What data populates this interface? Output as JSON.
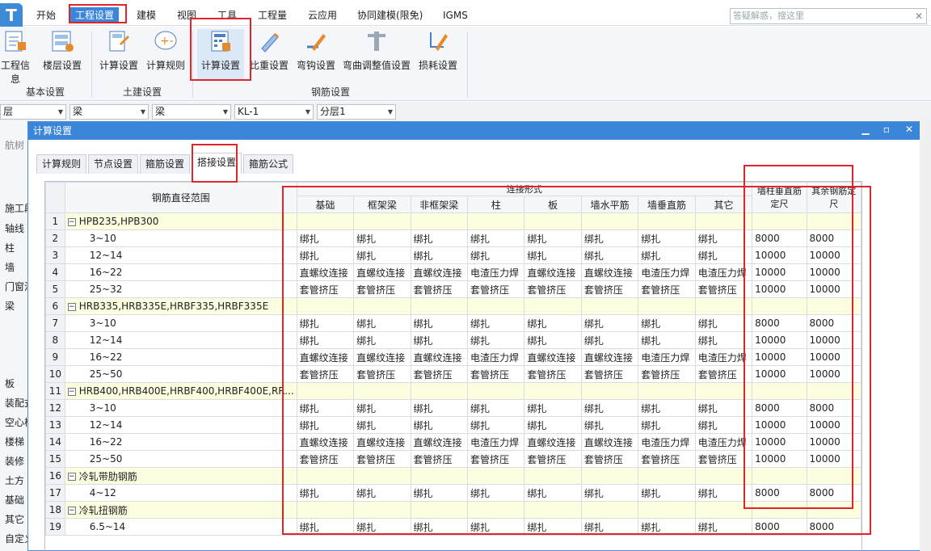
{
  "menu": {
    "items": [
      "开始",
      "工程设置",
      "建模",
      "视图",
      "工具",
      "工程量",
      "云应用",
      "协同建模(限免)",
      "IGMS"
    ],
    "active": "工程设置",
    "search_placeholder": "答疑解惑，搜这里",
    "search_clear": "✕"
  },
  "ribbon": {
    "buttons": [
      "工程信息",
      "楼层设置",
      "计算设置",
      "计算规则",
      "计算设置",
      "比重设置",
      "弯钩设置",
      "弯曲调整值设置",
      "损耗设置"
    ],
    "groups": [
      "基本设置",
      "土建设置",
      "钢筋设置"
    ]
  },
  "combos": [
    "层",
    "梁",
    "梁",
    "KL-1",
    "分层1"
  ],
  "left_nav": {
    "items": [
      "航树",
      "施工段",
      "轴线",
      "柱",
      "墙",
      "门窗洞",
      "梁",
      "板",
      "装配式",
      "空心楼",
      "楼梯",
      "装修",
      "土方",
      "基础",
      "其它",
      "自定义"
    ]
  },
  "dialog": {
    "title": "计算设置",
    "tabs": [
      "计算规则",
      "节点设置",
      "箍筋设置",
      "搭接设置",
      "箍筋公式"
    ],
    "active_tab": "搭接设置",
    "grid": {
      "range_header": "钢筋直径范围",
      "group_header": "连接形式",
      "col_headers": [
        "基础",
        "框架梁",
        "非框架梁",
        "柱",
        "板",
        "墙水平筋",
        "墙垂直筋",
        "其它"
      ],
      "extra_headers": [
        "墙柱垂直筋定尺",
        "其余钢筋定尺"
      ],
      "rows": [
        {
          "n": "1",
          "label": "HPB235,HPB300",
          "group": true,
          "cells": []
        },
        {
          "n": "2",
          "label": "3~10",
          "cells": [
            "绑扎",
            "绑扎",
            "绑扎",
            "绑扎",
            "绑扎",
            "绑扎",
            "绑扎",
            "绑扎",
            "8000",
            "8000"
          ]
        },
        {
          "n": "3",
          "label": "12~14",
          "cells": [
            "绑扎",
            "绑扎",
            "绑扎",
            "绑扎",
            "绑扎",
            "绑扎",
            "绑扎",
            "绑扎",
            "10000",
            "10000"
          ]
        },
        {
          "n": "4",
          "label": "16~22",
          "cells": [
            "直螺纹连接",
            "直螺纹连接",
            "直螺纹连接",
            "电渣压力焊",
            "直螺纹连接",
            "直螺纹连接",
            "电渣压力焊",
            "电渣压力焊",
            "10000",
            "10000"
          ]
        },
        {
          "n": "5",
          "label": "25~32",
          "cells": [
            "套管挤压",
            "套管挤压",
            "套管挤压",
            "套管挤压",
            "套管挤压",
            "套管挤压",
            "套管挤压",
            "套管挤压",
            "10000",
            "10000"
          ]
        },
        {
          "n": "6",
          "label": "HRB335,HRB335E,HRBF335,HRBF335E",
          "group": true,
          "cells": []
        },
        {
          "n": "7",
          "label": "3~10",
          "cells": [
            "绑扎",
            "绑扎",
            "绑扎",
            "绑扎",
            "绑扎",
            "绑扎",
            "绑扎",
            "绑扎",
            "8000",
            "8000"
          ]
        },
        {
          "n": "8",
          "label": "12~14",
          "cells": [
            "绑扎",
            "绑扎",
            "绑扎",
            "绑扎",
            "绑扎",
            "绑扎",
            "绑扎",
            "绑扎",
            "10000",
            "10000"
          ]
        },
        {
          "n": "9",
          "label": "16~22",
          "cells": [
            "直螺纹连接",
            "直螺纹连接",
            "直螺纹连接",
            "电渣压力焊",
            "直螺纹连接",
            "直螺纹连接",
            "电渣压力焊",
            "电渣压力焊",
            "10000",
            "10000"
          ]
        },
        {
          "n": "10",
          "label": "25~50",
          "cells": [
            "套管挤压",
            "套管挤压",
            "套管挤压",
            "套管挤压",
            "套管挤压",
            "套管挤压",
            "套管挤压",
            "套管挤压",
            "10000",
            "10000"
          ]
        },
        {
          "n": "11",
          "label": "HRB400,HRB400E,HRBF400,HRBF400E,RR...",
          "group": true,
          "cells": []
        },
        {
          "n": "12",
          "label": "3~10",
          "cells": [
            "绑扎",
            "绑扎",
            "绑扎",
            "绑扎",
            "绑扎",
            "绑扎",
            "绑扎",
            "绑扎",
            "8000",
            "8000"
          ]
        },
        {
          "n": "13",
          "label": "12~14",
          "cells": [
            "绑扎",
            "绑扎",
            "绑扎",
            "绑扎",
            "绑扎",
            "绑扎",
            "绑扎",
            "绑扎",
            "10000",
            "10000"
          ]
        },
        {
          "n": "14",
          "label": "16~22",
          "cells": [
            "直螺纹连接",
            "直螺纹连接",
            "直螺纹连接",
            "电渣压力焊",
            "直螺纹连接",
            "直螺纹连接",
            "电渣压力焊",
            "电渣压力焊",
            "10000",
            "10000"
          ]
        },
        {
          "n": "15",
          "label": "25~50",
          "cells": [
            "套管挤压",
            "套管挤压",
            "套管挤压",
            "套管挤压",
            "套管挤压",
            "套管挤压",
            "套管挤压",
            "套管挤压",
            "10000",
            "10000"
          ]
        },
        {
          "n": "16",
          "label": "冷轧带肋钢筋",
          "group": true,
          "cells": []
        },
        {
          "n": "17",
          "label": "4~12",
          "cells": [
            "绑扎",
            "绑扎",
            "绑扎",
            "绑扎",
            "绑扎",
            "绑扎",
            "绑扎",
            "绑扎",
            "8000",
            "8000"
          ]
        },
        {
          "n": "18",
          "label": "冷轧扭钢筋",
          "group": true,
          "cells": []
        },
        {
          "n": "19",
          "label": "6.5~14",
          "cells": [
            "绑扎",
            "绑扎",
            "绑扎",
            "绑扎",
            "绑扎",
            "绑扎",
            "绑扎",
            "绑扎",
            "8000",
            "8000"
          ]
        }
      ]
    }
  },
  "colors": {
    "accent": "#3b86d8",
    "highlight": "#e0252b",
    "group_row": "#fdfde0"
  }
}
